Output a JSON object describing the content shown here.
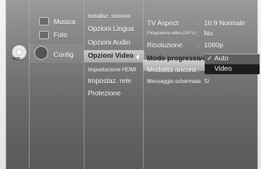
{
  "nav": {
    "items": [
      {
        "label": "Musica"
      },
      {
        "label": "Foto"
      },
      {
        "label": "Config"
      }
    ],
    "disc_label": "DVD"
  },
  "submenu": {
    "items": [
      {
        "label": "Installaz. sistema"
      },
      {
        "label": "Opzioni Lingua"
      },
      {
        "label": "Opzioni Audio"
      },
      {
        "label": "Opzioni Video"
      },
      {
        "label": "Impostazione HDMI"
      },
      {
        "label": "Impostaz. rete"
      },
      {
        "label": "Protezione"
      }
    ]
  },
  "settings": {
    "rows": [
      {
        "label": "TV Aspect",
        "value": "16:9 Normale"
      },
      {
        "label": "Fotogramma video (24 Fs)",
        "value": "No"
      },
      {
        "label": "Risoluzione",
        "value": "1080p"
      },
      {
        "label": "Modo progressivo",
        "value": ""
      },
      {
        "label": "Modalità ancora",
        "value": ""
      },
      {
        "label": "Messaggio schermata",
        "value": "Sì"
      }
    ],
    "separator": ":"
  },
  "popup": {
    "options": [
      {
        "label": "Auto",
        "checked": true
      },
      {
        "label": "Video",
        "checked": false
      }
    ]
  },
  "colors": {
    "panel": "#7b7b7b",
    "highlight": "#bdbdbd",
    "selected_option": "#1d1d1d"
  },
  "icons": {
    "disc": "disc-icon",
    "music": "music-icon",
    "photo": "photo-icon",
    "gear": "gear-icon",
    "check": "check-icon",
    "left_arrow": "left-arrow-icon"
  }
}
